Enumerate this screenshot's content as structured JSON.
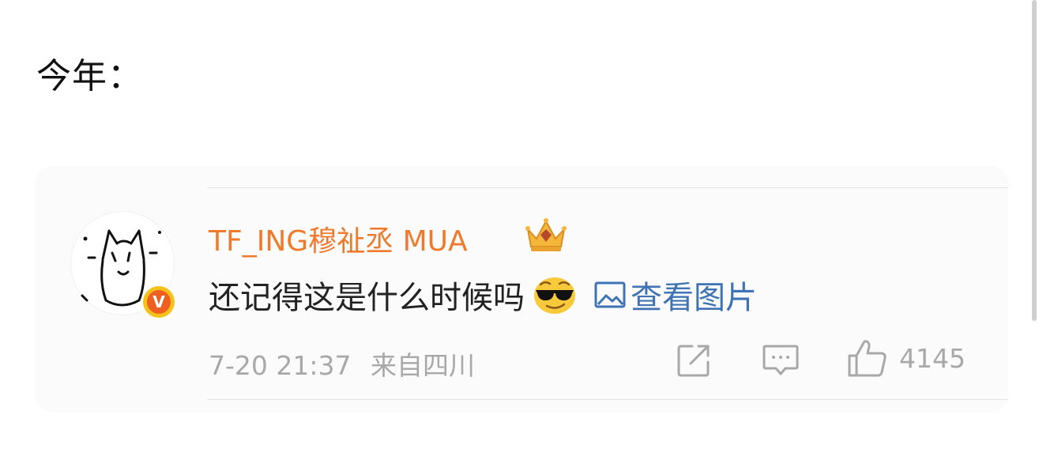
{
  "heading": "今年：",
  "comment": {
    "username": "TF_ING穆祉丞 MUA",
    "text": "还记得这是什么时候吗",
    "view_image_label": "查看图片",
    "time": "7-20 21:37",
    "location": "来自四川",
    "like_count": "4145",
    "badge_letter": "V"
  },
  "colors": {
    "username": "#ef7a2b",
    "link": "#3f73b4",
    "meta": "#a8a8a8"
  },
  "icons": {
    "crown": "crown-icon",
    "emoji": "sunglasses-emoji-icon",
    "picture": "picture-icon",
    "share": "share-icon",
    "comment": "comment-icon",
    "like": "thumbs-up-icon"
  }
}
